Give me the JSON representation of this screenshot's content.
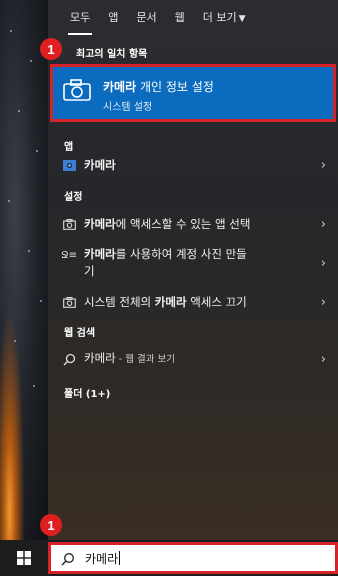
{
  "tabs": [
    "모두",
    "앱",
    "문서",
    "웹",
    "더 보기"
  ],
  "best_match": {
    "section_title": "최고의 일치 항목",
    "title_bold": "카메라",
    "title_rest": " 개인 정보 설정",
    "subtitle": "시스템 설정",
    "badge": "1"
  },
  "apps": {
    "section_title": "앱",
    "items": [
      {
        "label_bold": "카메라",
        "label_rest": ""
      }
    ]
  },
  "settings": {
    "section_title": "설정",
    "items": [
      {
        "label_bold": "카메라",
        "label_rest": "에 액세스할 수 있는 앱 선택"
      },
      {
        "label_bold": "카메라",
        "label_rest": "를 사용하여 계정 사진 만들",
        "label_line2": "기"
      },
      {
        "label_pre": "시스템 전체의 ",
        "label_bold": "카메라",
        "label_rest": " 액세스 끄기"
      }
    ]
  },
  "web_search": {
    "section_title": "웹 검색",
    "item": {
      "label": "카메라",
      "suffix": " - 웹 결과 보기"
    }
  },
  "folders": {
    "section_title": "폴더 (1+)"
  },
  "taskbar": {
    "search_value": "카메라",
    "badge": "1"
  },
  "colors": {
    "accent": "#0b6cbf",
    "highlight_border": "#d6232a",
    "badge": "#e02020"
  }
}
